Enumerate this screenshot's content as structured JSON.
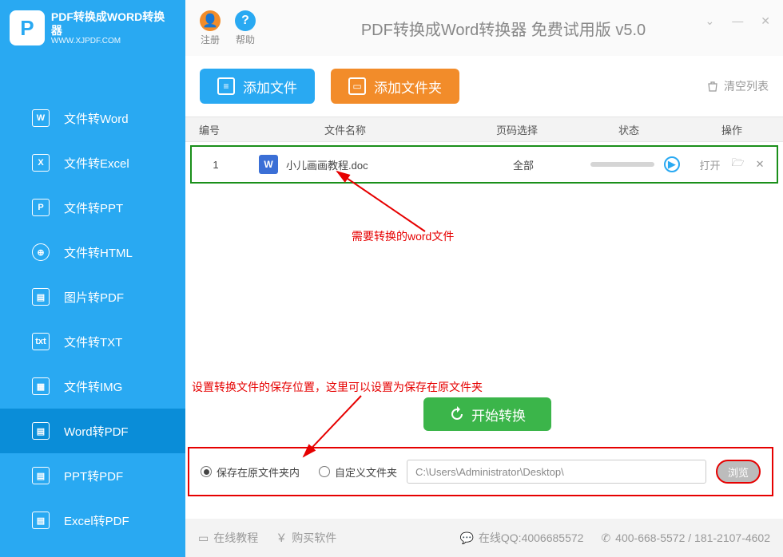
{
  "logo": {
    "letter": "P",
    "title": "PDF转换成WORD转换器",
    "url": "WWW.XJPDF.COM"
  },
  "topbar": {
    "register": "注册",
    "help": "帮助",
    "title": "PDF转换成Word转换器 免费试用版 v5.0"
  },
  "sidebar": {
    "items": [
      {
        "icon": "W",
        "label": "文件转Word"
      },
      {
        "icon": "X",
        "label": "文件转Excel"
      },
      {
        "icon": "P",
        "label": "文件转PPT"
      },
      {
        "icon": "⊕",
        "label": "文件转HTML",
        "round": true
      },
      {
        "icon": "▤",
        "label": "图片转PDF"
      },
      {
        "icon": "txt",
        "label": "文件转TXT"
      },
      {
        "icon": "▦",
        "label": "文件转IMG"
      },
      {
        "icon": "▤",
        "label": "Word转PDF",
        "active": true
      },
      {
        "icon": "▤",
        "label": "PPT转PDF"
      },
      {
        "icon": "▤",
        "label": "Excel转PDF"
      }
    ]
  },
  "actions": {
    "add_file": "添加文件",
    "add_folder": "添加文件夹",
    "clear_list": "清空列表"
  },
  "table": {
    "headers": {
      "num": "编号",
      "name": "文件名称",
      "page": "页码选择",
      "state": "状态",
      "op": "操作"
    },
    "row": {
      "num": "1",
      "icon": "W",
      "name": "小儿画画教程.doc",
      "page": "全部",
      "op_open": "打开"
    }
  },
  "annotations": {
    "a1": "需要转换的word文件",
    "a2": "设置转换文件的保存位置，这里可以设置为保存在原文件夹"
  },
  "convert": "开始转换",
  "save": {
    "opt1": "保存在原文件夹内",
    "opt2": "自定义文件夹",
    "path": "C:\\Users\\Administrator\\Desktop\\",
    "browse": "浏览"
  },
  "footer": {
    "tutorial": "在线教程",
    "buy": "购买软件",
    "qq": "在线QQ:4006685572",
    "phone": "400-668-5572 / 181-2107-4602"
  }
}
